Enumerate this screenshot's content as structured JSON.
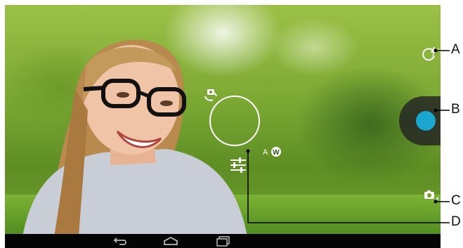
{
  "callouts": {
    "a": "A",
    "b": "B",
    "c": "C",
    "d": "D"
  },
  "controls": {
    "flash_icon": "flash-auto-icon",
    "shutter_icon": "shutter-button",
    "gallery_icon": "camera-switch-small-icon",
    "switch_camera_icon": "switch-camera-icon",
    "white_balance_icon": "white-balance-auto-icon",
    "settings_icon": "settings-sliders-icon",
    "white_balance_text": "AW"
  },
  "navigation": {
    "back_icon": "back-icon",
    "home_icon": "home-icon",
    "recents_icon": "recent-apps-icon"
  },
  "colors": {
    "shutter_accent": "#1aa6cf",
    "nav_bar": "#050505"
  }
}
